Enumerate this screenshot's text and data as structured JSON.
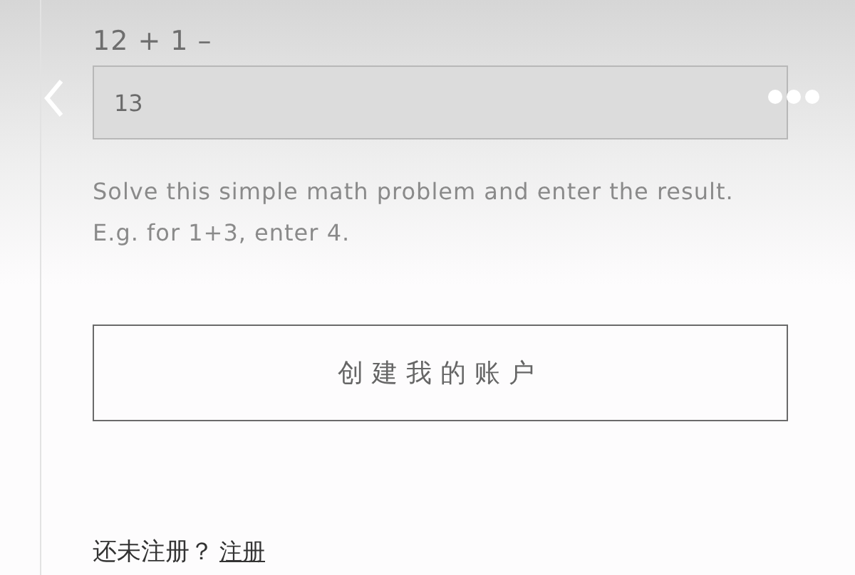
{
  "captcha": {
    "question": "12 + 1 –",
    "value": "13",
    "hint": "Solve this simple math problem and enter the result. E.g. for 1+3, enter 4."
  },
  "create_button": {
    "label": "创建我的账户"
  },
  "footer": {
    "prompt": "还未注册？",
    "link": "注册"
  }
}
